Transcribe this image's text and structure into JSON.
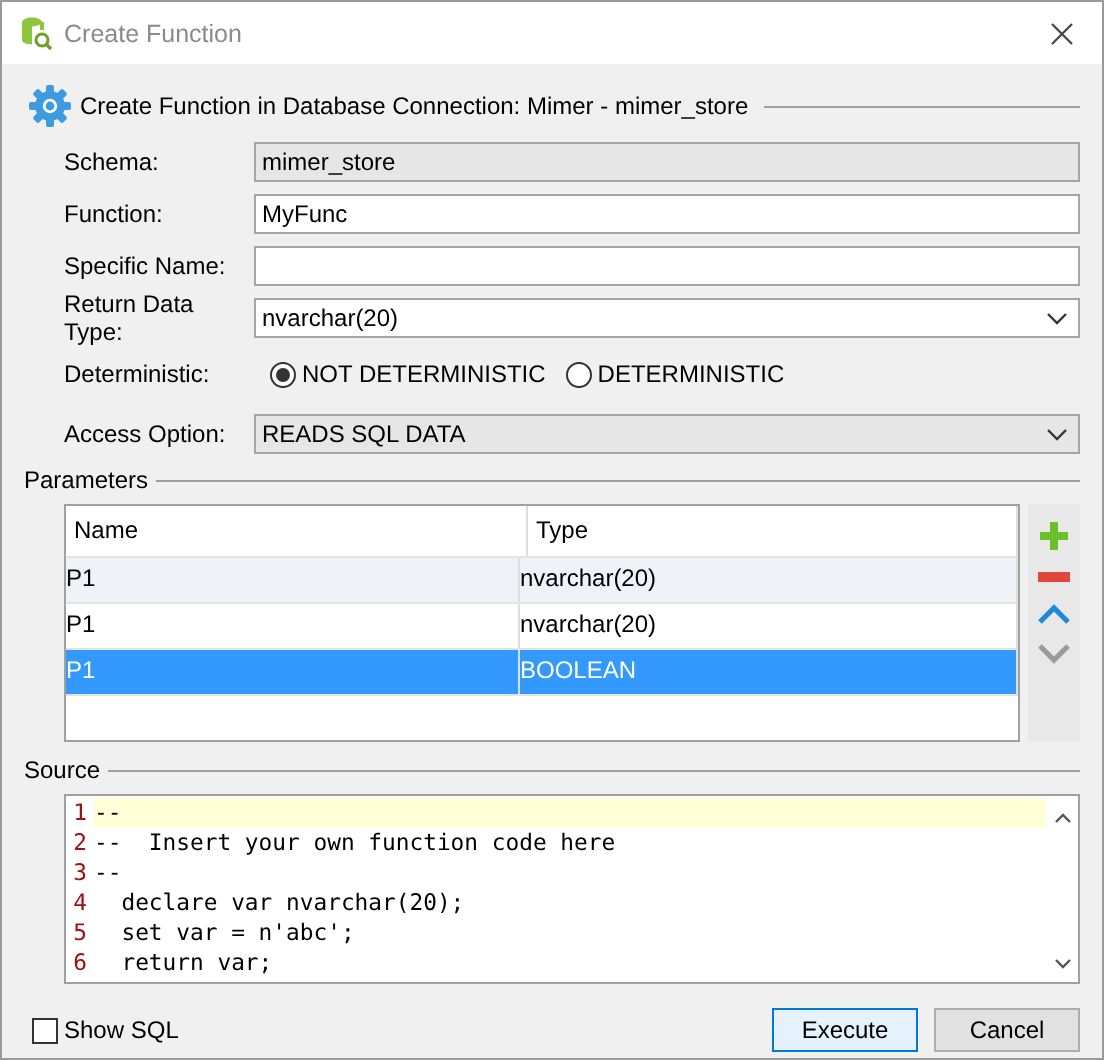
{
  "window": {
    "title": "Create Function"
  },
  "header": {
    "text": "Create Function in Database Connection: Mimer - mimer_store"
  },
  "fields": [
    {
      "kind": "text",
      "label": "Schema:",
      "value": "mimer_store",
      "disabled": true
    },
    {
      "kind": "text",
      "label": "Function:",
      "value": "MyFunc",
      "disabled": false
    },
    {
      "kind": "text",
      "label": "Specific Name:",
      "disabled": false
    },
    {
      "kind": "select",
      "label": "Return Data Type:",
      "value": "nvarchar(20)",
      "disabled": false
    },
    {
      "kind": "radio",
      "label": "Deterministic:",
      "options": [
        {
          "label": "NOT DETERMINISTIC",
          "selected": true
        },
        {
          "label": "DETERMINISTIC",
          "selected": false
        }
      ]
    },
    {
      "kind": "select",
      "label": "Access Option:",
      "value": "READS SQL DATA",
      "disabled": true
    }
  ],
  "parameters": {
    "title": "Parameters",
    "columns": [
      "Name",
      "Type"
    ],
    "rows": [
      {
        "name": "P1",
        "type": "nvarchar(20)",
        "selected": false
      },
      {
        "name": "P1",
        "type": "nvarchar(20)",
        "selected": false
      },
      {
        "name": "P1",
        "type": "BOOLEAN",
        "selected": true
      }
    ]
  },
  "source": {
    "title": "Source",
    "lines": [
      {
        "number": "1",
        "text": "--",
        "current": true
      },
      {
        "number": "2",
        "text": "--  Insert your own function code here",
        "current": false
      },
      {
        "number": "3",
        "text": "--",
        "current": false
      },
      {
        "number": "4",
        "text": "  declare var nvarchar(20);",
        "current": false
      },
      {
        "number": "5",
        "text": "  set var = n'abc';",
        "current": false
      },
      {
        "number": "6",
        "text": "  return var;",
        "current": false
      }
    ]
  },
  "show_sql": {
    "label": "Show SQL",
    "checked": false
  },
  "buttons": [
    {
      "label": "Execute",
      "default": true
    },
    {
      "label": "Cancel",
      "default": false
    }
  ]
}
